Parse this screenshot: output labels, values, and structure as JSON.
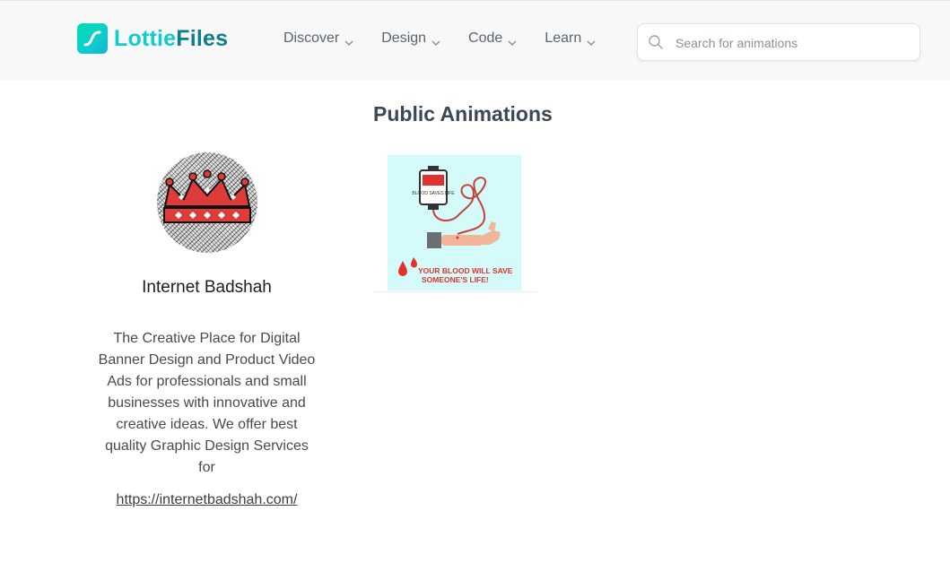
{
  "header": {
    "logo": {
      "text_primary": "Lottie",
      "text_secondary": "Files"
    },
    "nav": [
      {
        "label": "Discover"
      },
      {
        "label": "Design"
      },
      {
        "label": "Code"
      },
      {
        "label": "Learn"
      }
    ],
    "search": {
      "placeholder": "Search for animations",
      "value": ""
    }
  },
  "profile": {
    "name": "Internet Badshah",
    "bio": "The Creative Place for Digital Banner Design and Product Video Ads for professionals and small businesses with innovative and creative ideas. We offer best quality Graphic Design Services for",
    "link": "https://internetbadshah.com/"
  },
  "animations": {
    "title": "Public Animations",
    "items": [
      {
        "caption_line1": "YOUR BLOOD WILL SAVE",
        "caption_line2": "SOMEONE'S LIFE!",
        "bag_label": "BLOOD SAVES LIFE"
      }
    ]
  },
  "colors": {
    "brand_teal": "#0fccce",
    "brand_dark_teal": "#0b7f8a",
    "header_bg": "#f8f8f8",
    "blood_red": "#e2322f",
    "thumb_bg": "#d4fafa"
  },
  "icons": {
    "logo": "lottie-logo-icon",
    "chevron": "chevron-down-icon",
    "search": "search-icon"
  }
}
